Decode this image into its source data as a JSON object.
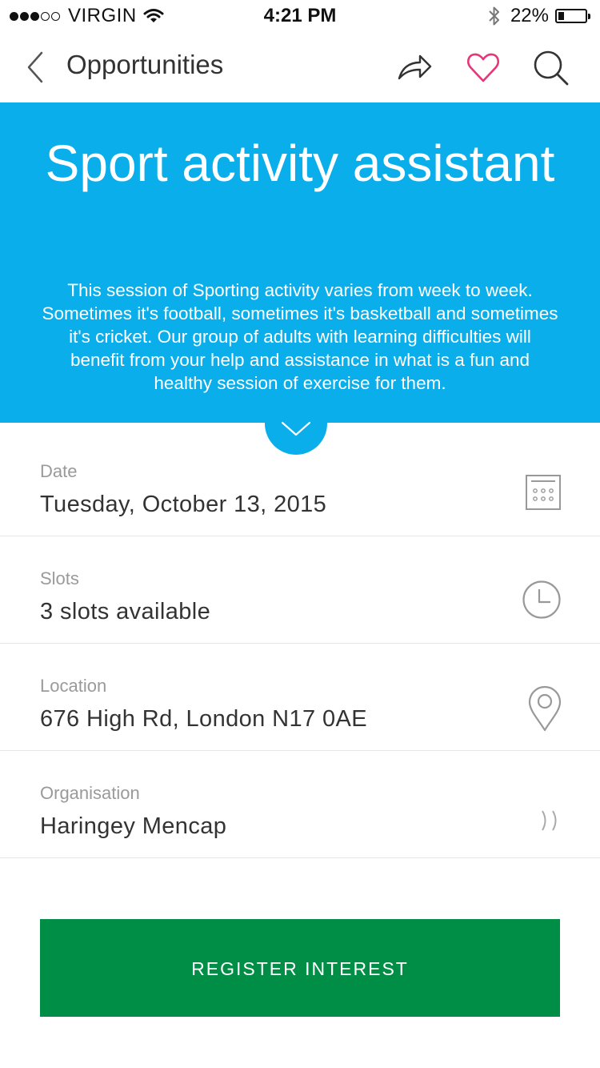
{
  "status_bar": {
    "carrier": "VIRGIN",
    "time": "4:21 PM",
    "battery_percent": "22%",
    "battery_level": 0.22,
    "signal_bars": 3,
    "signal_max": 5
  },
  "nav": {
    "title": "Opportunities",
    "back_icon": "chevron-left-icon",
    "share_icon": "share-icon",
    "favorite_icon": "heart-icon",
    "search_icon": "search-icon"
  },
  "opportunity": {
    "title": "Sport activity assistant",
    "description": "This session of Sporting activity varies from week to week. Sometimes it's football, sometimes it's basketball and sometimes it's cricket. Our group of adults with learning difficulties will benefit from your help and assistance in what is a fun and healthy session of exercise for them."
  },
  "details": {
    "date": {
      "label": "Date",
      "value": "Tuesday, October 13, 2015"
    },
    "slots": {
      "label": "Slots",
      "value": "3 slots available"
    },
    "location": {
      "label": "Location",
      "value": "676 High Rd, London N17 0AE"
    },
    "organisation": {
      "label": "Organisation",
      "value": "Haringey Mencap"
    }
  },
  "actions": {
    "register_label": "REGISTER INTEREST"
  },
  "colors": {
    "hero_background": "#0aaeea",
    "register_button": "#008d45",
    "heart_accent": "#e8357a",
    "label_gray": "#9a9a9a"
  }
}
